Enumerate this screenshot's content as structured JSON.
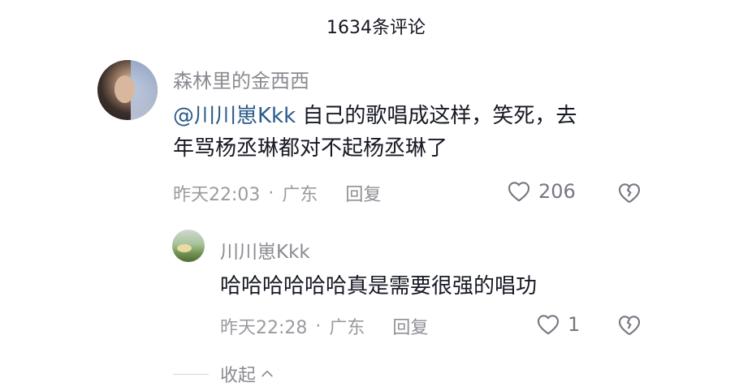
{
  "header": {
    "title": "1634条评论"
  },
  "comments": [
    {
      "username": "森林里的金西西",
      "mention": "@川川崽Kkk",
      "text_line1": " 自己的歌唱成这样，笑死，去",
      "text_line2": "年骂杨丞琳都对不起杨丞琳了",
      "time": "昨天22:03",
      "dot": "·",
      "location": "广东",
      "reply_label": "回复",
      "likes": "206"
    },
    {
      "username": "川川崽Kkk",
      "text": "哈哈哈哈哈哈真是需要很强的唱功",
      "time": "昨天22:28",
      "dot": "·",
      "location": "广东",
      "reply_label": "回复",
      "likes": "1"
    }
  ],
  "collapse_label": "收起",
  "icons": {
    "like": "heart-outline-icon",
    "dislike": "broken-heart-icon",
    "collapse": "chevron-up-icon"
  },
  "colors": {
    "text": "#161823",
    "secondary": "#8a8b91",
    "mention": "#2b5b8a"
  }
}
